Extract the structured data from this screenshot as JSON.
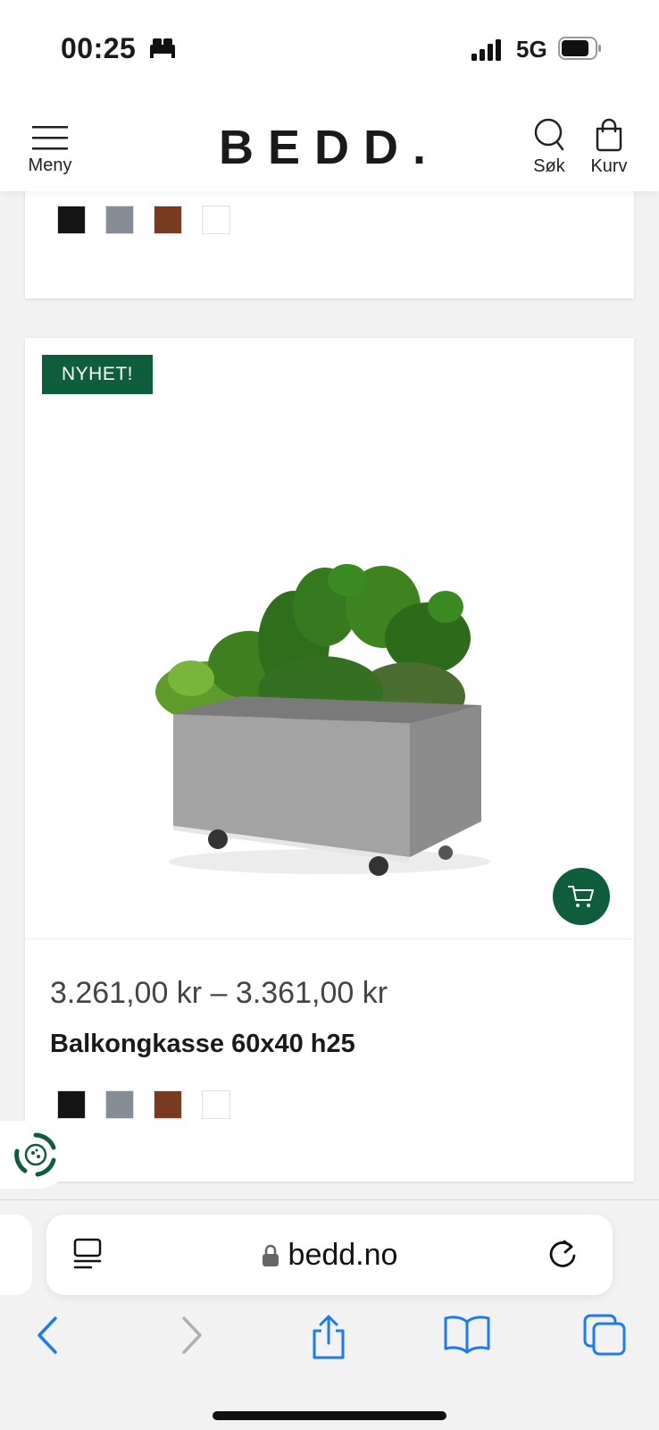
{
  "status": {
    "time": "00:25",
    "network": "5G"
  },
  "header": {
    "menu_label": "Meny",
    "logo": "BEDD.",
    "search_label": "Søk",
    "cart_label": "Kurv"
  },
  "colors": {
    "brand_green": "#0e5e3e",
    "swatch_black": "#141414",
    "swatch_gray": "#868d97",
    "swatch_rust": "#7a3a1f",
    "swatch_white": "#ffffff",
    "safari_blue": "#1a7cf5"
  },
  "previous_product": {
    "swatches": [
      "black",
      "gray",
      "rust",
      "white"
    ]
  },
  "product": {
    "badge": "NYHET!",
    "price": "3.261,00 kr – 3.361,00 kr",
    "title": "Balkongkasse 60x40 h25",
    "swatches": [
      "black",
      "gray",
      "rust",
      "white"
    ],
    "image_icon": "planter-with-herbs-image",
    "add_to_cart_icon": "cart-icon"
  },
  "browser": {
    "url": "bedd.no",
    "icons": [
      "reader-icon",
      "lock-icon",
      "reload-icon",
      "back-icon",
      "forward-icon",
      "share-icon",
      "bookmarks-icon",
      "tabs-icon"
    ]
  }
}
